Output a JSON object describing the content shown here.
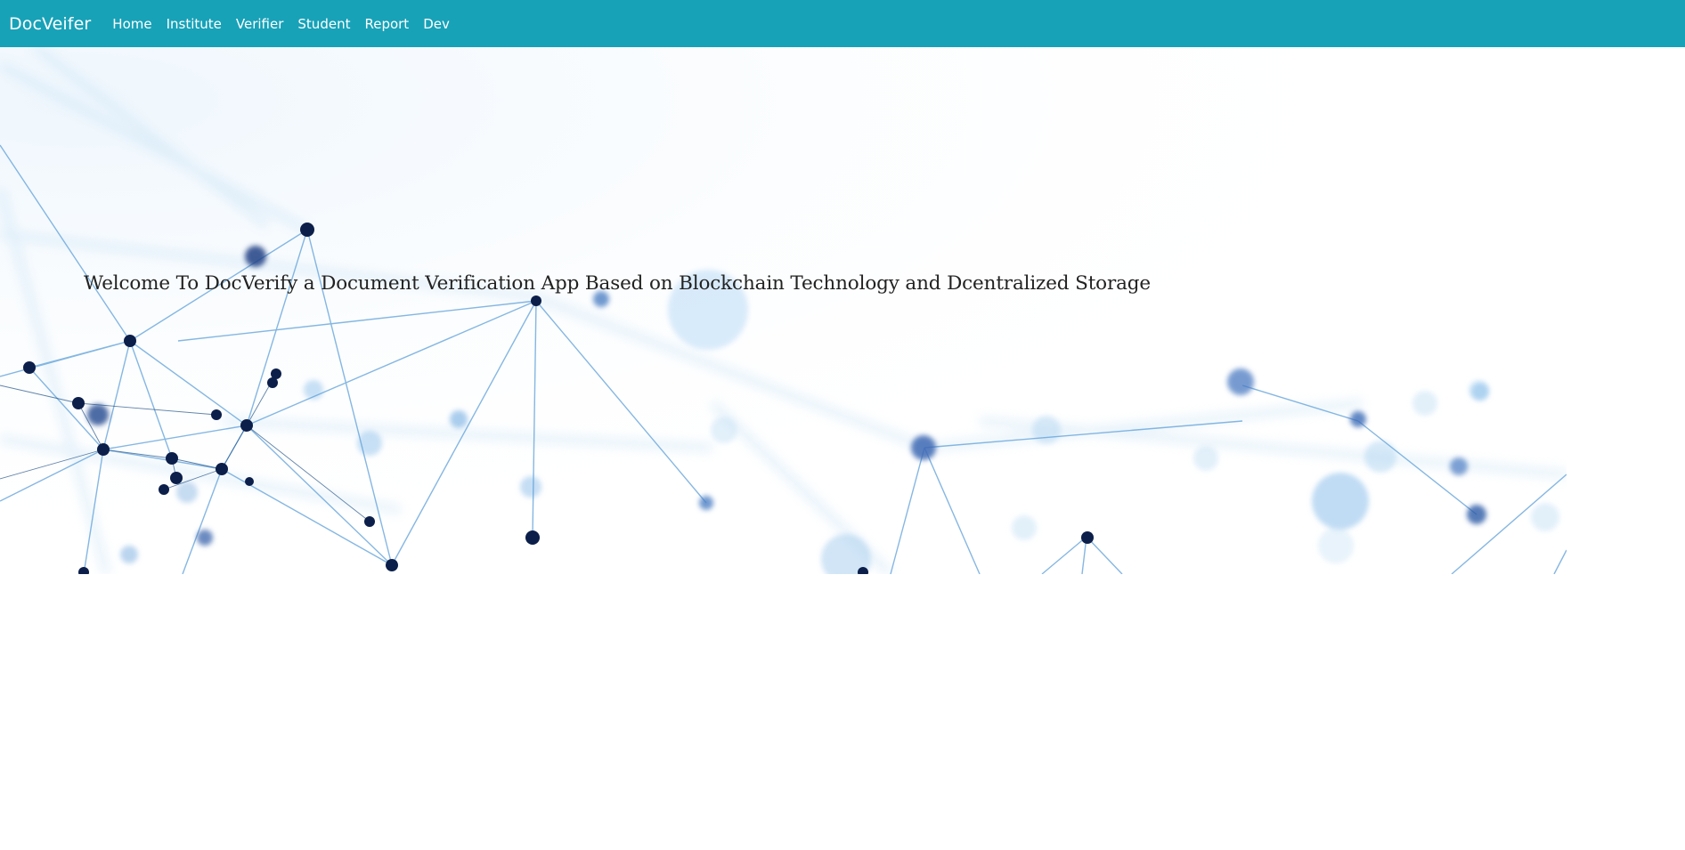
{
  "navbar": {
    "brand": "DocVeifer",
    "background": "#17a2b8",
    "links": [
      {
        "label": "Home"
      },
      {
        "label": "Institute"
      },
      {
        "label": "Verifier"
      },
      {
        "label": "Student"
      },
      {
        "label": "Report"
      },
      {
        "label": "Dev"
      }
    ]
  },
  "hero": {
    "headline": "Welcome To DocVerify a Document Verification App Based on Blockchain Technology and Dcentralized Storage",
    "background_image": "blue-network-nodes-graphic"
  }
}
